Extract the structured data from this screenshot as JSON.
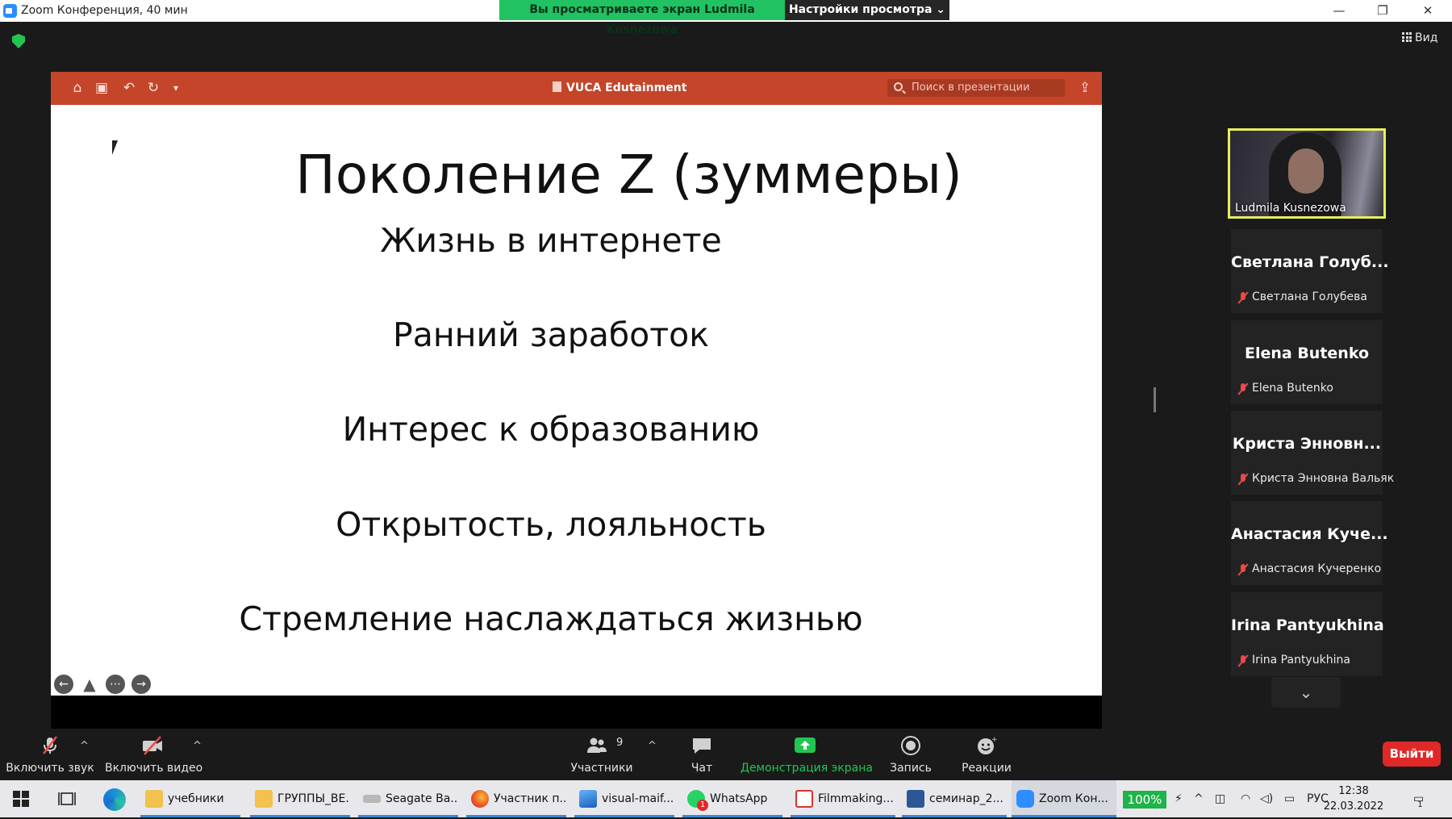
{
  "window": {
    "title": "Zoom Конференция, 40 мин",
    "share_banner": "Вы просматриваете экран Ludmila Kusnezowa",
    "view_settings": "Настройки просмотра ⌄",
    "minimize": "—",
    "restore": "❐",
    "close": "✕"
  },
  "zoom_top": {
    "view_label": "Вид"
  },
  "presentation": {
    "toolbar_icons": [
      "home-icon",
      "save-icon",
      "undo-icon",
      "redo-icon",
      "customize-icon"
    ],
    "title": "VUCA Edutainment",
    "search_placeholder": "Поиск в презентации",
    "slide": {
      "title": "Поколение Z (зуммеры)",
      "bullets": [
        "Жизнь в интернете",
        "Ранний заработок",
        "Интерес к образованию",
        "Открытость, лояльность",
        "Стремление наслаждаться жизнью"
      ]
    }
  },
  "participants": {
    "active_speaker": "Ludmila Kusnezowa",
    "tiles": [
      {
        "big": "Светлана Голуб...",
        "small": "Светлана Голубева"
      },
      {
        "big": "Elena Butenko",
        "small": "Elena Butenko"
      },
      {
        "big": "Криста Энновн...",
        "small": "Криста Энновна Вальяк"
      },
      {
        "big": "Анастасия Куче...",
        "small": "Анастасия Кучеренко"
      },
      {
        "big": "Irina Pantyukhina",
        "small": "Irina Pantyukhina"
      }
    ]
  },
  "toolbar": {
    "unmute": "Включить звук",
    "start_video": "Включить видео",
    "participants_label": "Участники",
    "participants_count": "9",
    "chat": "Чат",
    "share_screen": "Демонстрация экрана",
    "record": "Запись",
    "reactions": "Реакции",
    "leave": "Выйти"
  },
  "taskbar": {
    "items": [
      {
        "label": "учебники",
        "icon": "folder-icon"
      },
      {
        "label": "ГРУППЫ_ВЕ...",
        "icon": "folder-icon"
      },
      {
        "label": "Seagate Ba...",
        "icon": "drive-icon"
      },
      {
        "label": "Участник п...",
        "icon": "firefox-icon"
      },
      {
        "label": "visual-maif...",
        "icon": "image-icon"
      },
      {
        "label": "WhatsApp",
        "icon": "whatsapp-icon",
        "badge": "1"
      },
      {
        "label": "Filmmaking...",
        "icon": "pdf-icon"
      },
      {
        "label": "семинар_2...",
        "icon": "word-icon"
      },
      {
        "label": "Zoom Кон...",
        "icon": "zoom-icon"
      }
    ],
    "battery": "100%",
    "language": "РУС",
    "time": "12:38",
    "date": "22.03.2022",
    "notification_count": "1"
  },
  "colors": {
    "share_banner": "#21c262",
    "ppt_bar": "#c4452a",
    "active_speaker_border": "#e6f05a",
    "leave_button": "#e02828",
    "share_screen_green": "#23c552"
  }
}
